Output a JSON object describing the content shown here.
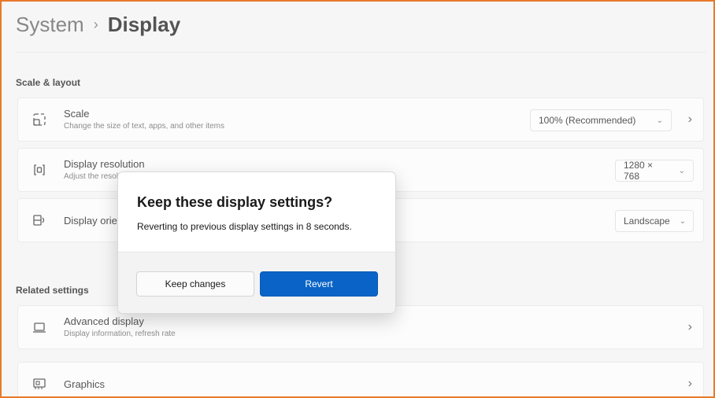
{
  "breadcrumb": {
    "parent": "System",
    "separator": "›",
    "current": "Display"
  },
  "sections": {
    "scale_layout": "Scale & layout",
    "related": "Related settings"
  },
  "settings": {
    "scale": {
      "label": "Scale",
      "sub": "Change the size of text, apps, and other items",
      "value": "100% (Recommended)"
    },
    "resolution": {
      "label": "Display resolution",
      "sub": "Adjust the resolution to fit your connected display",
      "value": "1280 × 768"
    },
    "orientation": {
      "label": "Display orientation",
      "value": "Landscape"
    }
  },
  "related": {
    "advanced": {
      "label": "Advanced display",
      "sub": "Display information, refresh rate"
    },
    "graphics": {
      "label": "Graphics"
    }
  },
  "dialog": {
    "title": "Keep these display settings?",
    "message": "Reverting to previous display settings in  8 seconds.",
    "keep_label": "Keep changes",
    "revert_label": "Revert"
  },
  "colors": {
    "accent": "#0a63c6",
    "frame_border": "#e8792b"
  }
}
